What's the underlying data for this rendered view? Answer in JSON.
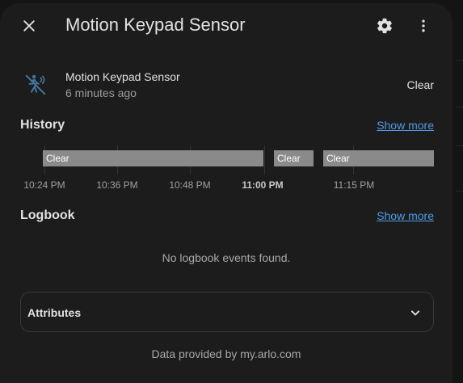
{
  "dialog": {
    "title": "Motion Keypad Sensor",
    "icons": {
      "close": "close-icon",
      "settings": "gear-icon",
      "more": "dots-vertical-icon"
    }
  },
  "entity": {
    "icon": "motion-sensor-off-icon",
    "name": "Motion Keypad Sensor",
    "last_changed": "6 minutes ago",
    "state": "Clear"
  },
  "history": {
    "title": "History",
    "show_more": "Show more",
    "bars": [
      {
        "label": "Clear"
      },
      {
        "label": "Clear"
      },
      {
        "label": "Clear"
      }
    ],
    "ticks": [
      {
        "label": "10:24 PM",
        "bold": false
      },
      {
        "label": "10:36 PM",
        "bold": false
      },
      {
        "label": "10:48 PM",
        "bold": false
      },
      {
        "label": "11:00 PM",
        "bold": true
      },
      {
        "label": "11:15 PM",
        "bold": false
      }
    ]
  },
  "logbook": {
    "title": "Logbook",
    "show_more": "Show more",
    "empty_message": "No logbook events found."
  },
  "attributes": {
    "label": "Attributes",
    "icon": "chevron-down-icon"
  },
  "attribution": "Data provided by my.arlo.com",
  "colors": {
    "surface": "#1c1c1c",
    "accent_link": "#4f9ae8",
    "bar": "#8a8a8a",
    "entity_icon": "#44739e"
  }
}
